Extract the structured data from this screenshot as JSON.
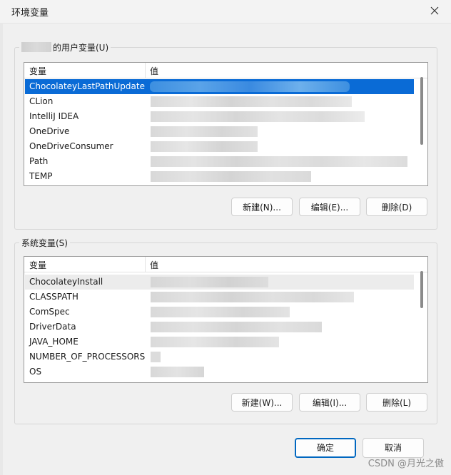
{
  "window": {
    "title": "环境变量",
    "close_label": "✕"
  },
  "user_section": {
    "legend": "的用户变量(U)",
    "columns": [
      "变量",
      "值"
    ],
    "rows": [
      {
        "name": "ChocolateyLastPathUpdate",
        "selected": true
      },
      {
        "name": "CLion"
      },
      {
        "name": "IntelliJ IDEA"
      },
      {
        "name": "OneDrive"
      },
      {
        "name": "OneDriveConsumer"
      },
      {
        "name": "Path"
      },
      {
        "name": "TEMP"
      }
    ],
    "buttons": {
      "new": "新建(N)...",
      "edit": "编辑(E)...",
      "delete": "删除(D)"
    }
  },
  "system_section": {
    "legend": "系统变量(S)",
    "columns": [
      "变量",
      "值"
    ],
    "rows": [
      {
        "name": "ChocolateyInstall",
        "hover": true
      },
      {
        "name": "CLASSPATH"
      },
      {
        "name": "ComSpec"
      },
      {
        "name": "DriverData"
      },
      {
        "name": "JAVA_HOME"
      },
      {
        "name": "NUMBER_OF_PROCESSORS"
      },
      {
        "name": "OS"
      }
    ],
    "buttons": {
      "new": "新建(W)...",
      "edit": "编辑(I)...",
      "delete": "删除(L)"
    }
  },
  "footer": {
    "ok": "确定",
    "cancel": "取消"
  },
  "watermark": "CSDN @月光之傲",
  "colors": {
    "selection": "#0a6bd6",
    "default_button_border": "#0067c0"
  }
}
